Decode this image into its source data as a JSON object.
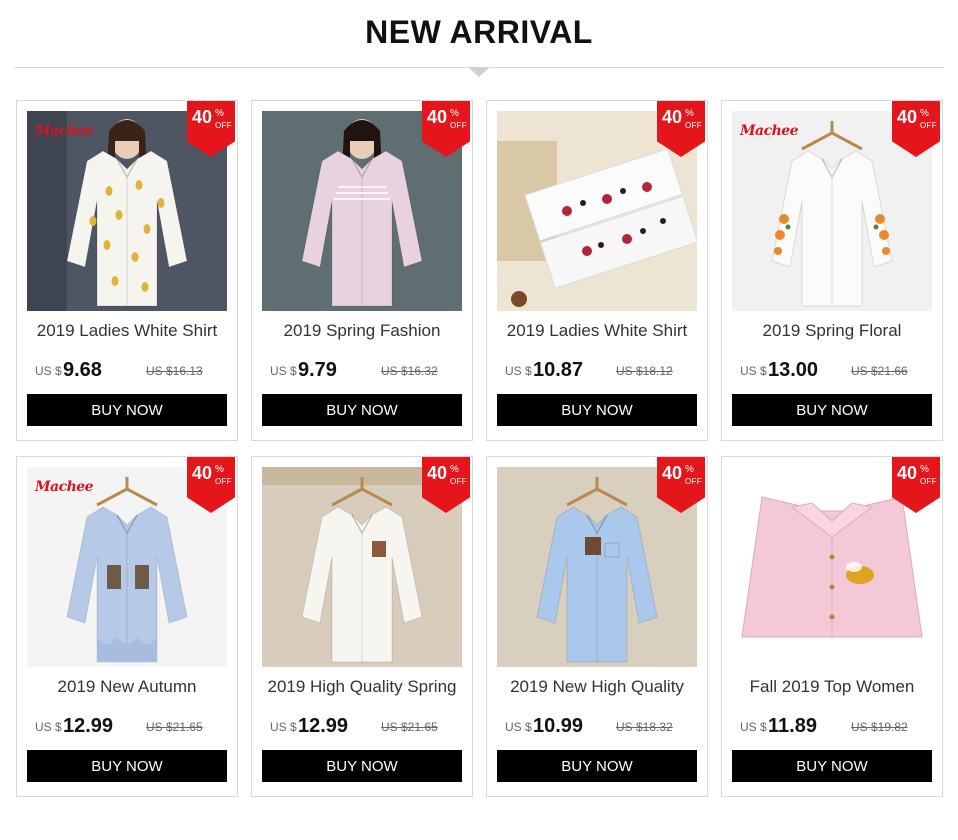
{
  "section_title": "NEW ARRIVAL",
  "brand_logo_text": "Machee",
  "badge": {
    "discount": "40",
    "percent_sign": "%",
    "off_label": "OFF"
  },
  "colors": {
    "badge": "#e4161c",
    "button": "#000000"
  },
  "products": [
    {
      "name": "2019 Ladies White Shirt",
      "currency": "US $",
      "price": "9.68",
      "old_price": "US $16.13",
      "button": "BUY NOW",
      "has_brand_logo": true,
      "image": "woman-white-printed-shirt"
    },
    {
      "name": "2019 Spring Fashion",
      "currency": "US $",
      "price": "9.79",
      "old_price": "US $16.32",
      "button": "BUY NOW",
      "has_brand_logo": false,
      "image": "woman-pink-striped-shirt"
    },
    {
      "name": "2019 Ladies White Shirt",
      "currency": "US $",
      "price": "10.87",
      "old_price": "US $18.12",
      "button": "BUY NOW",
      "has_brand_logo": false,
      "image": "folded-white-cat-print-shirts"
    },
    {
      "name": "2019 Spring Floral",
      "currency": "US $",
      "price": "13.00",
      "old_price": "US $21.66",
      "button": "BUY NOW",
      "has_brand_logo": true,
      "image": "white-floral-embroidered-shirt"
    },
    {
      "name": "2019 New Autumn",
      "currency": "US $",
      "price": "12.99",
      "old_price": "US $21.65",
      "button": "BUY NOW",
      "has_brand_logo": true,
      "image": "blue-striped-ruffle-shirt"
    },
    {
      "name": "2019 High Quality Spring",
      "currency": "US $",
      "price": "12.99",
      "old_price": "US $21.65",
      "button": "BUY NOW",
      "has_brand_logo": false,
      "image": "white-shirt-embroidered-patch"
    },
    {
      "name": "2019 New High Quality",
      "currency": "US $",
      "price": "10.99",
      "old_price": "US $18.32",
      "button": "BUY NOW",
      "has_brand_logo": false,
      "image": "light-blue-shirt-embroidered-patch"
    },
    {
      "name": "Fall 2019 Top Women",
      "currency": "US $",
      "price": "11.89",
      "old_price": "US $19.82",
      "button": "BUY NOW",
      "has_brand_logo": false,
      "image": "pink-shirt-bee-embroidery"
    }
  ]
}
